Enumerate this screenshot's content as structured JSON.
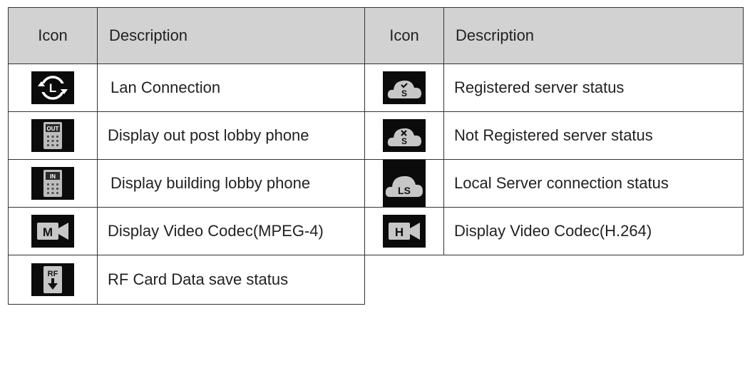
{
  "header": {
    "icon_col_1": "Icon",
    "desc_col_1": "Description",
    "icon_col_2": "Icon",
    "desc_col_2": "Description"
  },
  "rows": [
    {
      "left_icon": "lan-connection-icon",
      "left_desc": "Lan Connection",
      "right_icon": "cloud-check-icon",
      "right_desc": "Registered server status"
    },
    {
      "left_icon": "out-post-lobby-phone-icon",
      "left_desc": "Display out post lobby phone",
      "right_icon": "cloud-x-icon",
      "right_desc": "Not Registered server status"
    },
    {
      "left_icon": "building-lobby-phone-icon",
      "left_desc": "Display building lobby phone",
      "right_icon": "cloud-ls-icon",
      "right_desc": "Local Server connection status"
    },
    {
      "left_icon": "mpeg4-camera-icon",
      "left_desc": "Display Video Codec(MPEG-4)",
      "right_icon": "h264-camera-icon",
      "right_desc": "Display Video Codec(H.264)"
    },
    {
      "left_icon": "rf-card-save-icon",
      "left_desc": "RF Card Data save status"
    }
  ],
  "icon_glyphs": {
    "lan": "L",
    "out": "OUT",
    "in": "IN",
    "mpeg": "M",
    "h264": "H",
    "rf": "RF",
    "server_ok": "S",
    "server_fail": "S",
    "local": "LS"
  }
}
